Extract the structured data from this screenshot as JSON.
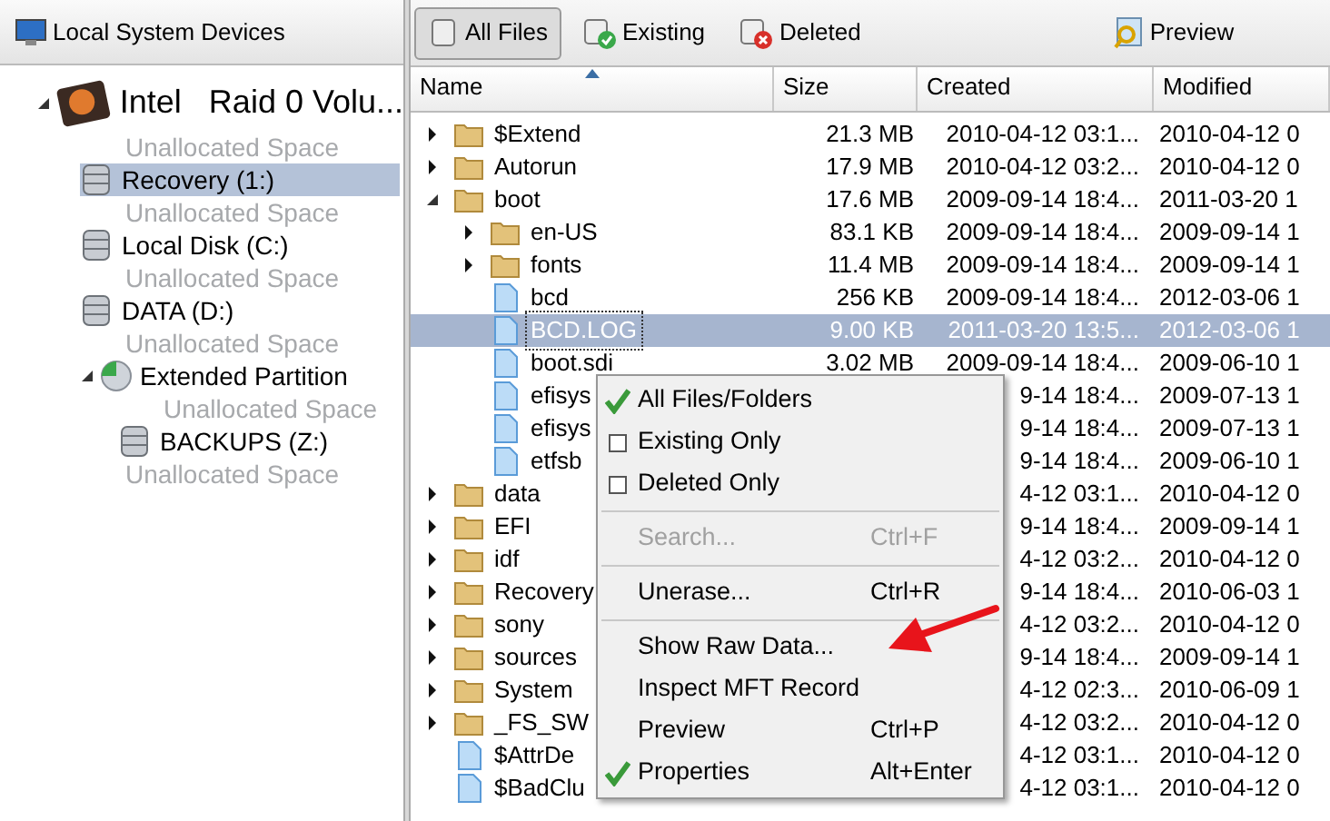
{
  "sidebar": {
    "title": "Local System Devices",
    "tree": [
      {
        "kind": "disk",
        "label": "Intel   Raid 0 Volu...",
        "expanded": true,
        "selected": false,
        "children": [
          {
            "kind": "unallocated",
            "label": "Unallocated Space",
            "selected": false
          },
          {
            "kind": "volume",
            "label": "Recovery (1:)",
            "selected": true
          },
          {
            "kind": "unallocated",
            "label": "Unallocated Space",
            "selected": false
          },
          {
            "kind": "volume",
            "label": "Local Disk (C:)",
            "selected": false
          },
          {
            "kind": "unallocated",
            "label": "Unallocated Space",
            "selected": false
          },
          {
            "kind": "volume",
            "label": "DATA (D:)",
            "selected": false
          },
          {
            "kind": "unallocated",
            "label": "Unallocated Space",
            "selected": false
          },
          {
            "kind": "extended",
            "label": "Extended Partition",
            "expanded": true,
            "selected": false,
            "children": [
              {
                "kind": "unallocated",
                "label": "Unallocated Space",
                "selected": false
              },
              {
                "kind": "volume",
                "label": "BACKUPS (Z:)",
                "selected": false
              }
            ]
          },
          {
            "kind": "unallocated",
            "label": "Unallocated Space",
            "selected": false
          }
        ]
      }
    ]
  },
  "toolbar": [
    {
      "kind": "all",
      "label": "All Files",
      "selected": true
    },
    {
      "kind": "existing",
      "label": "Existing",
      "selected": false
    },
    {
      "kind": "deleted",
      "label": "Deleted",
      "selected": false
    },
    {
      "kind": "preview",
      "label": "Preview",
      "selected": false
    }
  ],
  "table": {
    "columns": [
      {
        "label": "Name",
        "sorted": true
      },
      {
        "label": "Size",
        "sorted": false
      },
      {
        "label": "Created",
        "sorted": false
      },
      {
        "label": "Modified",
        "sorted": false
      }
    ],
    "rows": [
      {
        "kind": "folder",
        "name": "$Extend",
        "expanded": false,
        "selected": false,
        "size": "21.3 MB",
        "created": "2010-04-12 03:1...",
        "modified": "2010-04-12 0"
      },
      {
        "kind": "folder",
        "name": "Autorun",
        "expanded": false,
        "selected": false,
        "size": "17.9 MB",
        "created": "2010-04-12 03:2...",
        "modified": "2010-04-12 0"
      },
      {
        "kind": "folder",
        "name": "boot",
        "expanded": true,
        "selected": false,
        "size": "17.6 MB",
        "created": "2009-09-14 18:4...",
        "modified": "2011-03-20 1",
        "children": [
          {
            "kind": "folder",
            "name": "en-US",
            "expanded": false,
            "selected": false,
            "size": "83.1 KB",
            "created": "2009-09-14 18:4...",
            "modified": "2009-09-14 1"
          },
          {
            "kind": "folder",
            "name": "fonts",
            "expanded": false,
            "selected": false,
            "size": "11.4 MB",
            "created": "2009-09-14 18:4...",
            "modified": "2009-09-14 1"
          },
          {
            "kind": "file",
            "name": "bcd",
            "selected": false,
            "size": "256 KB",
            "created": "2009-09-14 18:4...",
            "modified": "2012-03-06 1"
          },
          {
            "kind": "file",
            "name": "BCD.LOG",
            "selected": true,
            "size": "9.00 KB",
            "created": "2011-03-20 13:5...",
            "modified": "2012-03-06 1"
          },
          {
            "kind": "file",
            "name": "boot.sdi",
            "selected": false,
            "size": "3.02 MB",
            "created": "2009-09-14 18:4...",
            "modified": "2009-06-10 1"
          },
          {
            "kind": "file",
            "name": "efisys",
            "selected": false,
            "created": "9-14 18:4...",
            "modified": "2009-07-13 1"
          },
          {
            "kind": "file",
            "name": "efisys",
            "selected": false,
            "created": "9-14 18:4...",
            "modified": "2009-07-13 1"
          },
          {
            "kind": "file",
            "name": "etfsb",
            "selected": false,
            "created": "9-14 18:4...",
            "modified": "2009-06-10 1"
          }
        ]
      },
      {
        "kind": "folder",
        "name": "data",
        "expanded": false,
        "selected": false,
        "created": "4-12 03:1...",
        "modified": "2010-04-12 0"
      },
      {
        "kind": "folder",
        "name": "EFI",
        "expanded": false,
        "selected": false,
        "created": "9-14 18:4...",
        "modified": "2009-09-14 1"
      },
      {
        "kind": "folder",
        "name": "idf",
        "expanded": false,
        "selected": false,
        "created": "4-12 03:2...",
        "modified": "2010-04-12 0"
      },
      {
        "kind": "folder",
        "name": "Recovery",
        "expanded": false,
        "selected": false,
        "created": "9-14 18:4...",
        "modified": "2010-06-03 1"
      },
      {
        "kind": "folder",
        "name": "sony",
        "expanded": false,
        "selected": false,
        "created": "4-12 03:2...",
        "modified": "2010-04-12 0"
      },
      {
        "kind": "folder",
        "name": "sources",
        "expanded": false,
        "selected": false,
        "created": "9-14 18:4...",
        "modified": "2009-09-14 1"
      },
      {
        "kind": "folder",
        "name": "System",
        "expanded": false,
        "selected": false,
        "created": "4-12 02:3...",
        "modified": "2010-06-09 1"
      },
      {
        "kind": "folder",
        "name": "_FS_SW",
        "expanded": false,
        "selected": false,
        "created": "4-12 03:2...",
        "modified": "2010-04-12 0"
      },
      {
        "kind": "file",
        "name": "$AttrDe",
        "selected": false,
        "created": "4-12 03:1...",
        "modified": "2010-04-12 0"
      },
      {
        "kind": "file",
        "name": "$BadClu",
        "selected": false,
        "created": "4-12 03:1...",
        "modified": "2010-04-12 0"
      }
    ]
  },
  "context_menu": [
    {
      "kind": "check",
      "label": "All Files/Folders",
      "checked": true,
      "disabled": false
    },
    {
      "kind": "check",
      "label": "Existing Only",
      "checked": false,
      "disabled": false
    },
    {
      "kind": "check",
      "label": "Deleted Only",
      "checked": false,
      "disabled": false
    },
    {
      "kind": "separator"
    },
    {
      "kind": "action",
      "label": "Search...",
      "shortcut": "Ctrl+F",
      "disabled": true
    },
    {
      "kind": "separator"
    },
    {
      "kind": "action",
      "label": "Unerase...",
      "shortcut": "Ctrl+R",
      "disabled": false
    },
    {
      "kind": "separator"
    },
    {
      "kind": "action",
      "label": "Show Raw Data...",
      "disabled": false
    },
    {
      "kind": "action",
      "label": "Inspect MFT Record",
      "disabled": false
    },
    {
      "kind": "action",
      "label": "Preview",
      "shortcut": "Ctrl+P",
      "disabled": false
    },
    {
      "kind": "check",
      "label": "Properties",
      "shortcut": "Alt+Enter",
      "checked": true,
      "disabled": false
    }
  ]
}
